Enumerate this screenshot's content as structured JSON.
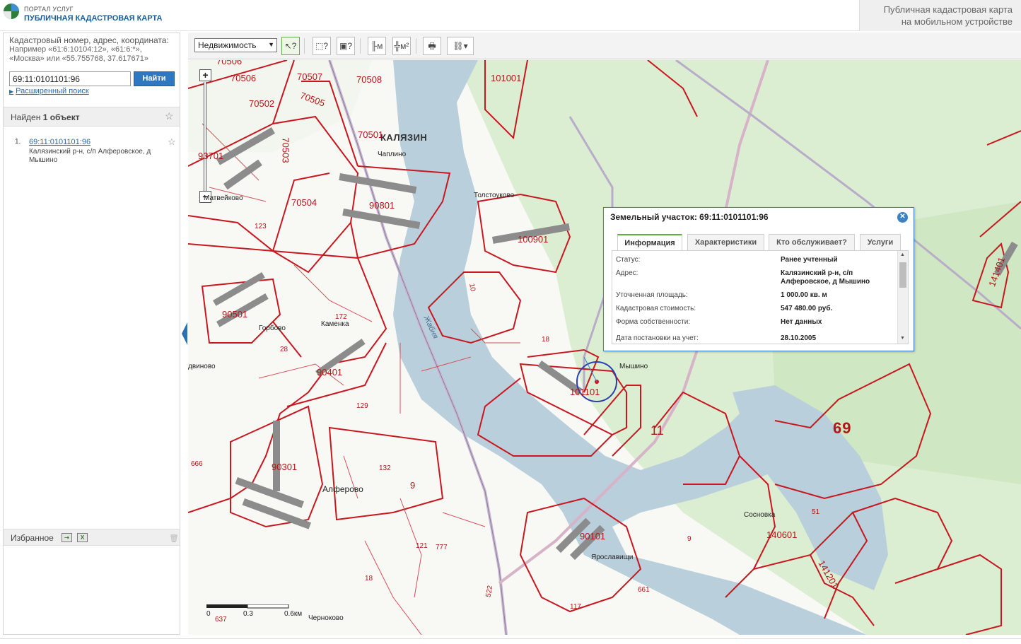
{
  "header": {
    "portal_small": "ПОРТАЛ УСЛУГ",
    "portal_main": "ПУБЛИЧНАЯ КАДАСТРОВАЯ КАРТА",
    "mobile_line1": "Публичная кадастровая карта",
    "mobile_line2": "на мобильном устройстве"
  },
  "search": {
    "hint_title": "Кадастровый номер, адрес, координата:",
    "hint_line1": "Например «61:6:10104:12», «61:6:*»,",
    "hint_line2": "«Москва» или «55.755768, 37.617671»",
    "value": "69:11:0101101:96",
    "button": "Найти",
    "advanced": "Расширенный поиск"
  },
  "results": {
    "found_prefix": "Найден ",
    "found_count": "1 объект",
    "items": [
      {
        "num": "1.",
        "cadastral": "69:11:0101101:96",
        "address": "Калязинский р-н, с/п Алферовское, д Мышино"
      }
    ]
  },
  "favorites": {
    "title": "Избранное"
  },
  "toolbar": {
    "select_value": "Недвижимость"
  },
  "map": {
    "parcels": [
      "70506",
      "70506",
      "70507",
      "70508",
      "101001",
      "70502",
      "70505",
      "70501",
      "70503",
      "93701",
      "70504",
      "90801",
      "123",
      "100901",
      "10",
      "90501",
      "172",
      "28",
      "90401",
      "18",
      "101101",
      "11",
      "69",
      "129",
      "90301",
      "132",
      "9",
      "666",
      "121",
      "777",
      "90101",
      "9",
      "140601",
      "51",
      "141201",
      "141401",
      "661",
      "117",
      "18",
      "637",
      "522"
    ],
    "places": [
      "КАЛЯЗИН",
      "Чаплино",
      "Толстоуково",
      "Матвейково",
      "Горбово",
      "Каменка",
      "Мышино",
      "Алферово",
      "Сосновка",
      "Ярославищи",
      "Черноково",
      "двиново"
    ],
    "river": "Жабня",
    "scale": {
      "zero": "0",
      "mid": "0.3",
      "end": "0.6км"
    }
  },
  "popup": {
    "title": "Земельный участок: 69:11:0101101:96",
    "tabs": [
      "Информация",
      "Характеристики",
      "Кто обслуживает?",
      "Услуги"
    ],
    "rows": [
      {
        "key": "Статус:",
        "value": "Ранее учтенный"
      },
      {
        "key": "Адрес:",
        "value": "Калязинский р-н, с/п Алферовское, д Мышино"
      },
      {
        "key": "Уточненная площадь:",
        "value": "1 000.00 кв. м"
      },
      {
        "key": "Кадастровая стоимость:",
        "value": "547 480.00 руб."
      },
      {
        "key": "Форма собственности:",
        "value": "Нет данных"
      },
      {
        "key": "Дата постановки на учет:",
        "value": "28.10.2005"
      }
    ]
  }
}
